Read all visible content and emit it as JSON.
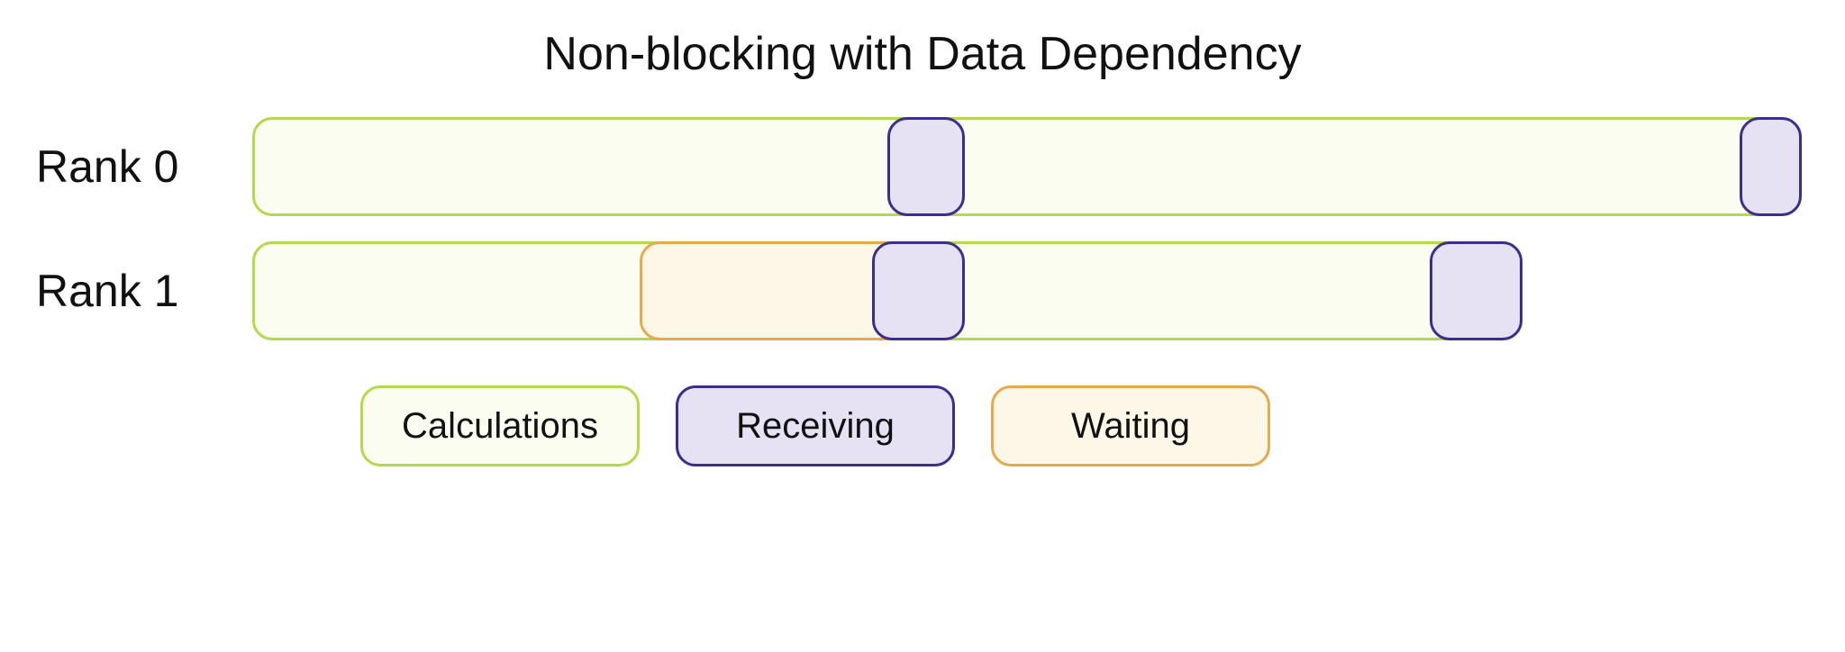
{
  "chart_data": {
    "type": "table",
    "title": "Non-blocking with Data Dependency",
    "legend": [
      "Calculations",
      "Receiving",
      "Waiting"
    ],
    "rows": [
      {
        "label": "Rank 0",
        "segments": [
          {
            "kind": "calc",
            "start": 0,
            "end": 100
          },
          {
            "kind": "recv",
            "start": 41,
            "end": 46
          },
          {
            "kind": "recv",
            "start": 96,
            "end": 100
          }
        ]
      },
      {
        "label": "Rank 1",
        "segments": [
          {
            "kind": "calc",
            "start": 0,
            "end": 82
          },
          {
            "kind": "wait",
            "start": 25,
            "end": 42
          },
          {
            "kind": "recv",
            "start": 40,
            "end": 46
          },
          {
            "kind": "recv",
            "start": 76,
            "end": 82
          }
        ]
      }
    ],
    "axis_range": [
      0,
      100
    ]
  }
}
